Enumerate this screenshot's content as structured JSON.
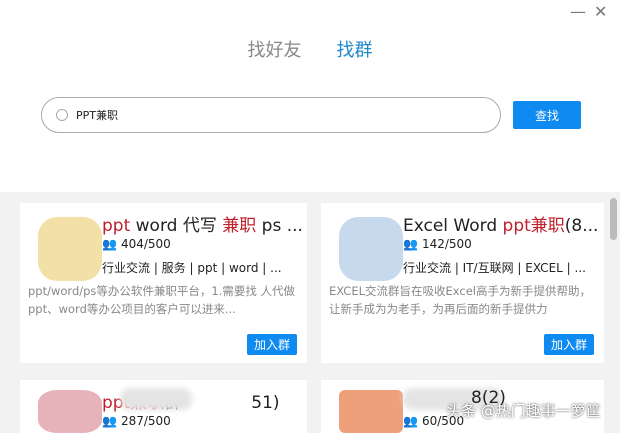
{
  "window": {
    "minimize": "—",
    "close": "✕"
  },
  "tabs": [
    {
      "label": "找好友"
    },
    {
      "label": "找群"
    }
  ],
  "search": {
    "value": "PPT兼职",
    "button": "查找"
  },
  "cards": [
    {
      "title_parts": [
        "ppt",
        "word 代写 ",
        "兼职",
        " ps ..."
      ],
      "members": "404/500",
      "tags": "行业交流 | 服务 | ppt | word | ...",
      "desc": "ppt/word/ps等办公软件兼职平台，1.需要找 人代做ppt、word等办公项目的客户可以进来...",
      "join": "加入群",
      "avatar_color": "#f0d890"
    },
    {
      "title_parts": [
        "",
        "Excel Word ",
        "ppt兼职",
        "(8..."
      ],
      "members": "142/500",
      "tags": "行业交流 | IT/互联网 | EXCEL | ...",
      "desc": "EXCEL交流群旨在吸收Excel高手为新手提供帮助，让新手成为为老手，为再后面的新手提供力",
      "join": "加入群",
      "avatar_color": "#b8cfe8"
    },
    {
      "title_parts": [
        "ppt兼职",
        "群",
        "",
        "51)"
      ],
      "members": "287/500",
      "avatar_color": "#e0a0aa"
    },
    {
      "title_parts": [
        "",
        "",
        "",
        "8(2)"
      ],
      "members": "60/500",
      "avatar_color": "#e88858"
    }
  ],
  "watermark": "头条 @热门趣事一箩筐"
}
